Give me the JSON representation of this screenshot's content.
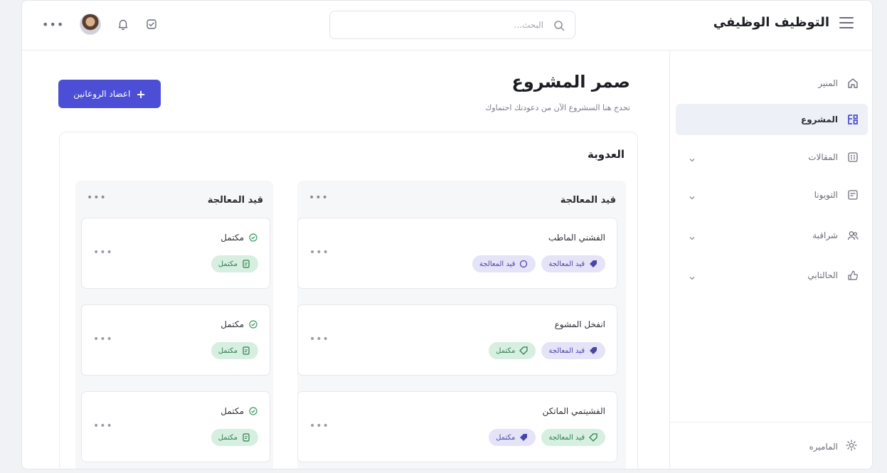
{
  "app": {
    "title": "التوظيف الوظيفي"
  },
  "search": {
    "placeholder": "البحث..."
  },
  "sidebar": {
    "items": [
      {
        "label": "المنير",
        "icon": "home-icon",
        "active": false,
        "chevron": false
      },
      {
        "label": "المشروع",
        "icon": "tasks-icon",
        "active": true,
        "chevron": false
      },
      {
        "label": "المقالات",
        "icon": "grid-icon",
        "active": false,
        "chevron": true
      },
      {
        "label": "التويونا",
        "icon": "calendar-icon",
        "active": false,
        "chevron": true
      },
      {
        "label": "شراقبة",
        "icon": "users-icon",
        "active": false,
        "chevron": true
      },
      {
        "label": "الحالتابي",
        "icon": "feedback-icon",
        "active": false,
        "chevron": true
      }
    ],
    "footer_label": "الماميره"
  },
  "page": {
    "title": "صمر المشروع",
    "subtitle": "تحدج هنا السشروع الآن من دعودتك احتماوك",
    "new_button": "اعضاد الروعانين"
  },
  "board": {
    "title": "العدوبة",
    "columns": [
      {
        "title": "قيد المعالجة",
        "cards": [
          {
            "title": "الفشني الماطب",
            "tags": [
              {
                "label": "قيد المعالجة",
                "color": "purple"
              },
              {
                "label": "قيد المعالجة",
                "color": "purple"
              }
            ]
          },
          {
            "title": "انفخل المشوع",
            "tags": [
              {
                "label": "قيد المعالجة",
                "color": "purple"
              },
              {
                "label": "مكتمل",
                "color": "green"
              }
            ]
          },
          {
            "title": "الفشيتمي الماتكن",
            "tags": [
              {
                "label": "قيد المعالجة",
                "color": "green"
              },
              {
                "label": "مكتمل",
                "color": "purple"
              }
            ]
          }
        ]
      },
      {
        "title": "قيد المعالجة",
        "cards": [
          {
            "title": "مكتمل",
            "tags": [
              {
                "label": "مكتمل",
                "color": "green"
              }
            ]
          },
          {
            "title": "مكتمل",
            "tags": [
              {
                "label": "مكتمل",
                "color": "green"
              }
            ]
          },
          {
            "title": "مكتمل",
            "tags": [
              {
                "label": "مكتمل",
                "color": "green"
              }
            ]
          }
        ]
      }
    ]
  },
  "colors": {
    "accent": "#4c4fd6",
    "purple_tag": "#e5e3f8",
    "green_tag": "#d6efe1"
  }
}
